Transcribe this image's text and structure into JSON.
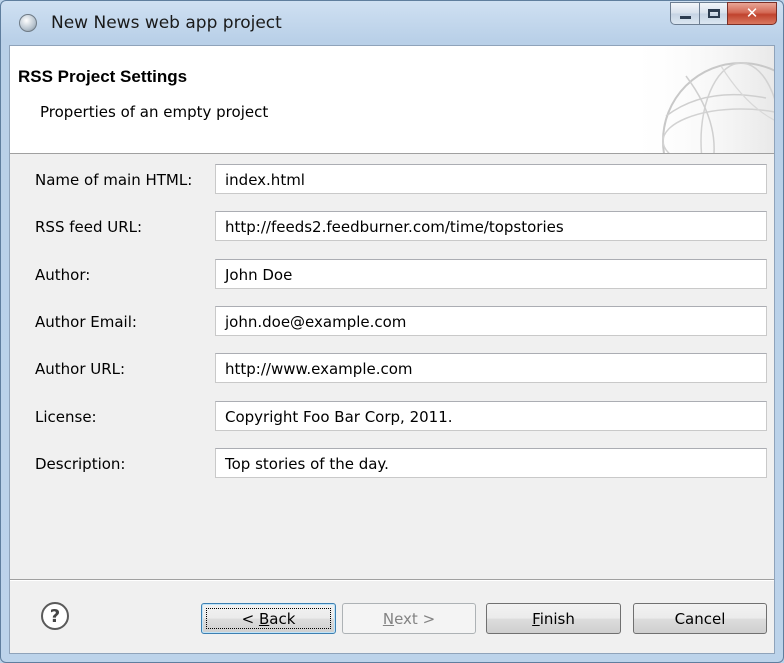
{
  "window": {
    "title": "New News web app project",
    "minimize_icon": "minimize-icon",
    "maximize_icon": "maximize-icon",
    "close_icon": "close-icon",
    "close_glyph": "✕"
  },
  "header": {
    "title": "RSS Project Settings",
    "description": "Properties of an empty project",
    "banner_icon": "globe-banner-icon"
  },
  "form": {
    "fields": [
      {
        "label": "Name of main HTML:",
        "value": "index.html"
      },
      {
        "label": "RSS feed URL:",
        "value": "http://feeds2.feedburner.com/time/topstories"
      },
      {
        "label": "Author:",
        "value": "John Doe"
      },
      {
        "label": "Author Email:",
        "value": "john.doe@example.com"
      },
      {
        "label": "Author URL:",
        "value": "http://www.example.com"
      },
      {
        "label": "License:",
        "value": "Copyright Foo Bar Corp, 2011."
      },
      {
        "label": "Description:",
        "value": "Top stories of the day."
      }
    ]
  },
  "buttons": {
    "help_glyph": "?",
    "back": {
      "pre": "< ",
      "mnemonic": "B",
      "post": "ack"
    },
    "next": {
      "mnemonic": "N",
      "post": "ext >"
    },
    "finish": {
      "mnemonic": "F",
      "post": "inish"
    },
    "cancel": "Cancel"
  },
  "colors": {
    "titlebar": "#bcd3ea",
    "close_button": "#c0432e",
    "client_bg": "#f0f0f0",
    "header_bg": "#ffffff",
    "focus_border": "#3c7fb1"
  }
}
